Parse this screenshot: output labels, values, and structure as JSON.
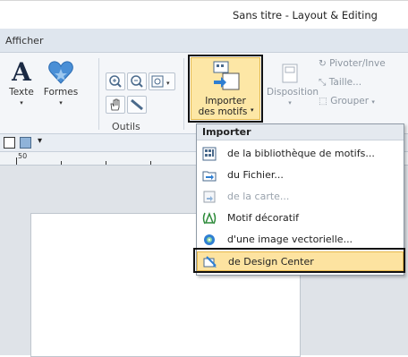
{
  "window": {
    "title": "Sans titre - Layout & Editing"
  },
  "menubar": {
    "tab": "Afficher"
  },
  "ribbon": {
    "texte": {
      "label": "Texte",
      "icon": "letter-a-icon"
    },
    "formes": {
      "label": "Formes",
      "icon": "heart-shape-icon"
    },
    "outils_group": "Outils",
    "importer": {
      "label_line1": "Importer",
      "label_line2": "des motifs",
      "icon": "import-design-icon"
    },
    "disposition": {
      "label": "Disposition",
      "icon": "layout-icon"
    },
    "pivoter": {
      "label": "Pivoter/Inve"
    },
    "taille": {
      "label": "Taille..."
    },
    "grouper": {
      "label": "Grouper"
    }
  },
  "ruler": {
    "mark": "50"
  },
  "dropdown": {
    "header": "Importer",
    "items": [
      {
        "label": "de la bibliothèque de motifs...",
        "icon": "library-icon",
        "enabled": true
      },
      {
        "label": "du Fichier...",
        "icon": "folder-icon",
        "enabled": true
      },
      {
        "label": "de la carte...",
        "icon": "card-icon",
        "enabled": false
      },
      {
        "label": "Motif décoratif",
        "icon": "decorative-pattern-icon",
        "enabled": true
      },
      {
        "label": "d'une image vectorielle...",
        "icon": "vector-image-icon",
        "enabled": true
      },
      {
        "label": "de Design Center",
        "icon": "design-center-icon",
        "enabled": true,
        "highlighted": true
      }
    ]
  },
  "colors": {
    "highlight": "#fde3a0",
    "ribbon_bg": "#f4f6f9",
    "accent_blue": "#4a8fd6"
  }
}
